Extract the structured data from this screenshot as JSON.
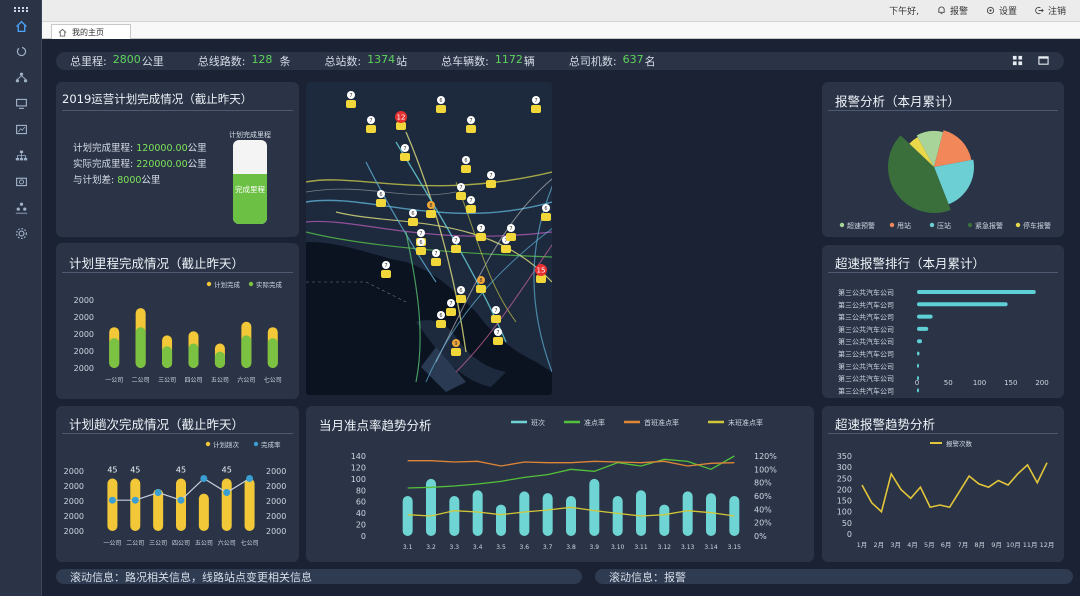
{
  "header": {
    "greeting": "下午好,",
    "alarm": "报警",
    "settings": "设置",
    "logout": "注销"
  },
  "tab": {
    "label": "我的主页"
  },
  "stats": [
    {
      "label": "总里程:",
      "value": "2800",
      "unit": "公里"
    },
    {
      "label": "总线路数:",
      "value": "128",
      "unit": "条"
    },
    {
      "label": "总站数:",
      "value": "1374",
      "unit": "站"
    },
    {
      "label": "总车辆数:",
      "value": "1172",
      "unit": "辆"
    },
    {
      "label": "总司机数:",
      "value": "637",
      "unit": "名"
    }
  ],
  "plan": {
    "title": "2019运营计划完成情况（截止昨天）",
    "planned_label": "计划完成里程:",
    "planned_value": "120000.00",
    "planned_unit": "公里",
    "actual_label": "实际完成里程:",
    "actual_value": "220000.00",
    "actual_unit": "公里",
    "diff_label": "与计划差:",
    "diff_value": "8000",
    "diff_unit": "公里",
    "gauge_caption": "计划完成里程",
    "gauge_label": "完成里程",
    "gauge_fill": 0.6
  },
  "mileage": {
    "title": "计划里程完成情况（截止昨天）",
    "chart_data": {
      "type": "bar",
      "categories": [
        "一公司",
        "二公司",
        "三公司",
        "四公司",
        "五公司",
        "六公司",
        "七公司"
      ],
      "series": [
        {
          "name": "计划完成",
          "values": [
            30,
            44,
            24,
            27,
            18,
            34,
            30
          ],
          "color": "#f2c838"
        },
        {
          "name": "实际完成",
          "values": [
            22,
            30,
            16,
            18,
            12,
            24,
            22
          ],
          "color": "#7cc242"
        }
      ],
      "yticks": [
        "2000",
        "2000",
        "2000",
        "2000",
        "2000"
      ],
      "ylim": [
        0,
        50
      ]
    }
  },
  "trips": {
    "title": "计划趟次完成情况（截止昨天）",
    "chart_data": {
      "type": "bar",
      "categories": [
        "一公司",
        "二公司",
        "三公司",
        "四公司",
        "五公司",
        "六公司",
        "七公司"
      ],
      "series": [
        {
          "name": "计划趟次",
          "values": [
            45,
            45,
            36,
            45,
            32,
            45,
            45
          ],
          "color": "#f2c838"
        },
        {
          "name": "完成率",
          "values": [
            0.44,
            0.44,
            0.55,
            0.44,
            0.75,
            0.55,
            0.75
          ],
          "color": "#3a9ed3"
        }
      ],
      "data_labels": [
        "45",
        "45",
        "",
        "45",
        "",
        "45",
        ""
      ],
      "yticks_left": [
        "2000",
        "2000",
        "2000",
        "2000",
        "2000"
      ],
      "yticks_right": [
        "2000",
        "2000",
        "2000",
        "2000",
        "2000"
      ],
      "ylim": [
        0,
        60
      ]
    }
  },
  "ontime": {
    "title": "当月准点率趋势分析",
    "chart_data": {
      "type": "bar",
      "categories": [
        "3.1",
        "3.2",
        "3.3",
        "3.4",
        "3.5",
        "3.6",
        "3.7",
        "3.8",
        "3.9",
        "3.10",
        "3.11",
        "3.12",
        "3.13",
        "3.14",
        "3.15"
      ],
      "series": [
        {
          "name": "班次",
          "values": [
            70,
            100,
            70,
            80,
            55,
            78,
            75,
            70,
            100,
            70,
            80,
            55,
            78,
            75,
            70
          ],
          "color": "#6fd4d4"
        },
        {
          "name": "准点率",
          "values": [
            0.72,
            0.73,
            0.75,
            0.78,
            0.82,
            0.88,
            0.92,
            1.0,
            0.97,
            1.1,
            1.05,
            1.15,
            1.12,
            1.0,
            1.2
          ],
          "color": "#54c13a"
        },
        {
          "name": "首班准点率",
          "values": [
            1.13,
            1.13,
            1.11,
            1.12,
            1.05,
            1.11,
            1.1,
            1.1,
            1.12,
            1.11,
            1.1,
            1.12,
            1.05,
            1.09,
            1.1
          ],
          "color": "#e08436"
        },
        {
          "name": "末班准点率",
          "values": [
            0.32,
            0.3,
            0.38,
            0.36,
            0.32,
            0.36,
            0.39,
            0.43,
            0.38,
            0.34,
            0.3,
            0.32,
            0.38,
            0.35,
            0.3
          ],
          "color": "#d2c736"
        }
      ],
      "yticks_left": [
        "140",
        "120",
        "100",
        "80",
        "60",
        "40",
        "20",
        "0"
      ],
      "yticks_right": [
        "120%",
        "100%",
        "80%",
        "60%",
        "40%",
        "20%",
        "0%"
      ],
      "ylim": [
        0,
        140
      ]
    }
  },
  "alarm": {
    "title": "报警分析（本月累计）",
    "chart_data": {
      "type": "pie",
      "categories": [
        "超速预警",
        "甩站",
        "压站",
        "紧急报警",
        "停车报警"
      ],
      "values": [
        12,
        18,
        22,
        43,
        5
      ],
      "colors": [
        "#a8d49a",
        "#f2885a",
        "#6ccfd4",
        "#3a6f3c",
        "#e8d84a"
      ]
    }
  },
  "speed_rank": {
    "title": "超速报警排行（本月累计）",
    "chart_data": {
      "type": "bar",
      "categories": [
        "第三公共汽车公司",
        "第三公共汽车公司",
        "第三公共汽车公司",
        "第三公共汽车公司",
        "第三公共汽车公司",
        "第三公共汽车公司",
        "第三公共汽车公司",
        "第三公共汽车公司",
        "第三公共汽车公司"
      ],
      "values": [
        190,
        145,
        25,
        18,
        8,
        4,
        3,
        2,
        1
      ],
      "xticks": [
        "0",
        "50",
        "100",
        "150",
        "200"
      ],
      "xlim": [
        0,
        200
      ]
    }
  },
  "speed_trend": {
    "title": "超速报警趋势分析",
    "chart_data": {
      "type": "line",
      "categories": [
        "1月",
        "2月",
        "3月",
        "4月",
        "5月",
        "6月",
        "7月",
        "8月",
        "9月",
        "10月",
        "11月",
        "12月"
      ],
      "series": [
        {
          "name": "报警次数",
          "values": [
            220,
            140,
            100,
            270,
            200,
            160,
            210,
            120,
            130,
            120,
            190,
            260,
            225,
            210,
            240,
            220,
            270,
            310,
            230,
            320
          ],
          "color": "#e3c53a"
        }
      ],
      "yticks": [
        "350",
        "300",
        "250",
        "200",
        "150",
        "100",
        "50",
        "0"
      ],
      "ylim": [
        0,
        350
      ]
    }
  },
  "map": {
    "bus_counts": [
      "7",
      "6",
      "7",
      "7",
      "12",
      "7",
      "6",
      "7",
      "6",
      "7",
      "7",
      "8",
      "6",
      "7",
      "7",
      "6",
      "6",
      "7",
      "15",
      "7",
      "7",
      "7",
      "8",
      "6",
      "7",
      "7",
      "6",
      "7",
      "9",
      "7",
      "7",
      "7"
    ]
  },
  "tickers": {
    "left": "滚动信息：路况相关信息，线路站点变更相关信息",
    "right": "滚动信息：报警"
  }
}
